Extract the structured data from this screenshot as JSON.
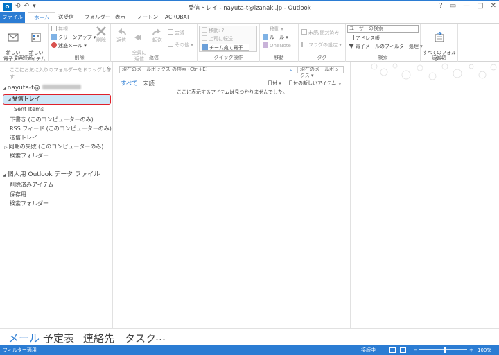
{
  "window": {
    "title": "受信トレイ - nayuta-t@izanaki.jp - Outlook",
    "app_icon": "O",
    "qat": [
      "⟲",
      "↶",
      "▾"
    ],
    "controls": [
      "?",
      "▭",
      "—",
      "□",
      "✕"
    ]
  },
  "tabs": [
    {
      "label": "ファイル"
    },
    {
      "label": "ホーム"
    },
    {
      "label": "送受信"
    },
    {
      "label": "フォルダー"
    },
    {
      "label": "表示"
    },
    {
      "label": "ノートン"
    },
    {
      "label": "ACROBAT"
    }
  ],
  "ribbon": {
    "new": {
      "label": "新規作成",
      "new_mail": "新しい\n電子メール",
      "new_items": "新しい\nアイテム"
    },
    "delete": {
      "label": "削除",
      "ignore": "無視",
      "cleanup": "クリーンアップ",
      "junk": "迷惑メール",
      "delete": "削除"
    },
    "respond": {
      "label": "返信",
      "reply": "返信",
      "reply_all": "全員に\n返信",
      "forward": "転送",
      "meeting": "会議",
      "more": "その他"
    },
    "quick_steps": {
      "label": "クイック操作",
      "move_to": "移動: ?",
      "to_manager": "上司に転送",
      "team_mail": "チーム宛て電子..."
    },
    "move": {
      "label": "移動",
      "move": "移動",
      "rules": "ルール",
      "onenote": "OneNote"
    },
    "tags": {
      "label": "タグ",
      "unread_read": "未読/開封済み",
      "followup": "フラグの設定"
    },
    "find": {
      "label": "検索",
      "search_people": "ユーザーの検索",
      "address_book": "アドレス帳",
      "filter_email": "電子メールのフィルター処理"
    },
    "send_receive": {
      "label": "送受信",
      "send_all": "すべてのフォルダー\nを送受信"
    }
  },
  "nav": {
    "favorites_hint": "ここにお気に入りのフォルダーをドラッグします",
    "collapse": "‹",
    "account1": "nayuta-t@",
    "account1_folders": [
      {
        "label": "受信トレイ",
        "selected": true
      },
      {
        "label": "Sent Items"
      },
      {
        "label": "下書き (このコンピューターのみ)"
      },
      {
        "label": "RSS フィード (このコンピューターのみ)"
      },
      {
        "label": "送信トレイ"
      },
      {
        "label": "同期の失敗 (このコンピューターのみ)"
      },
      {
        "label": "検索フォルダー"
      }
    ],
    "account2": "個人用 Outlook データ ファイル",
    "account2_folders": [
      {
        "label": "削除済みアイテム"
      },
      {
        "label": "保存用"
      },
      {
        "label": "検索フォルダー"
      }
    ]
  },
  "messages": {
    "search_placeholder": "現在のメールボックス の検索 (Ctrl+E)",
    "search_scope": "現在のメールボックス ▾",
    "filter_all": "すべて",
    "filter_unread": "未読",
    "sort_by": "日付 ▾",
    "sort_order": "日付の新しいアイテム ↓",
    "empty_message": "ここに表示するアイテムは見つかりませんでした。"
  },
  "bottom_nav": {
    "mail": "メール",
    "calendar": "予定表",
    "people": "連絡先",
    "tasks": "タスク",
    "more": "…"
  },
  "status": {
    "filter_applied": "フィルター適用",
    "connection": "接続中",
    "zoom_minus": "−",
    "zoom_plus": "+",
    "zoom": "100%",
    "zoom_level": 1.0
  },
  "colors": {
    "accent": "#2b7cd3",
    "selected_bg": "#cde6f7",
    "highlight_border": "#e0202a"
  }
}
